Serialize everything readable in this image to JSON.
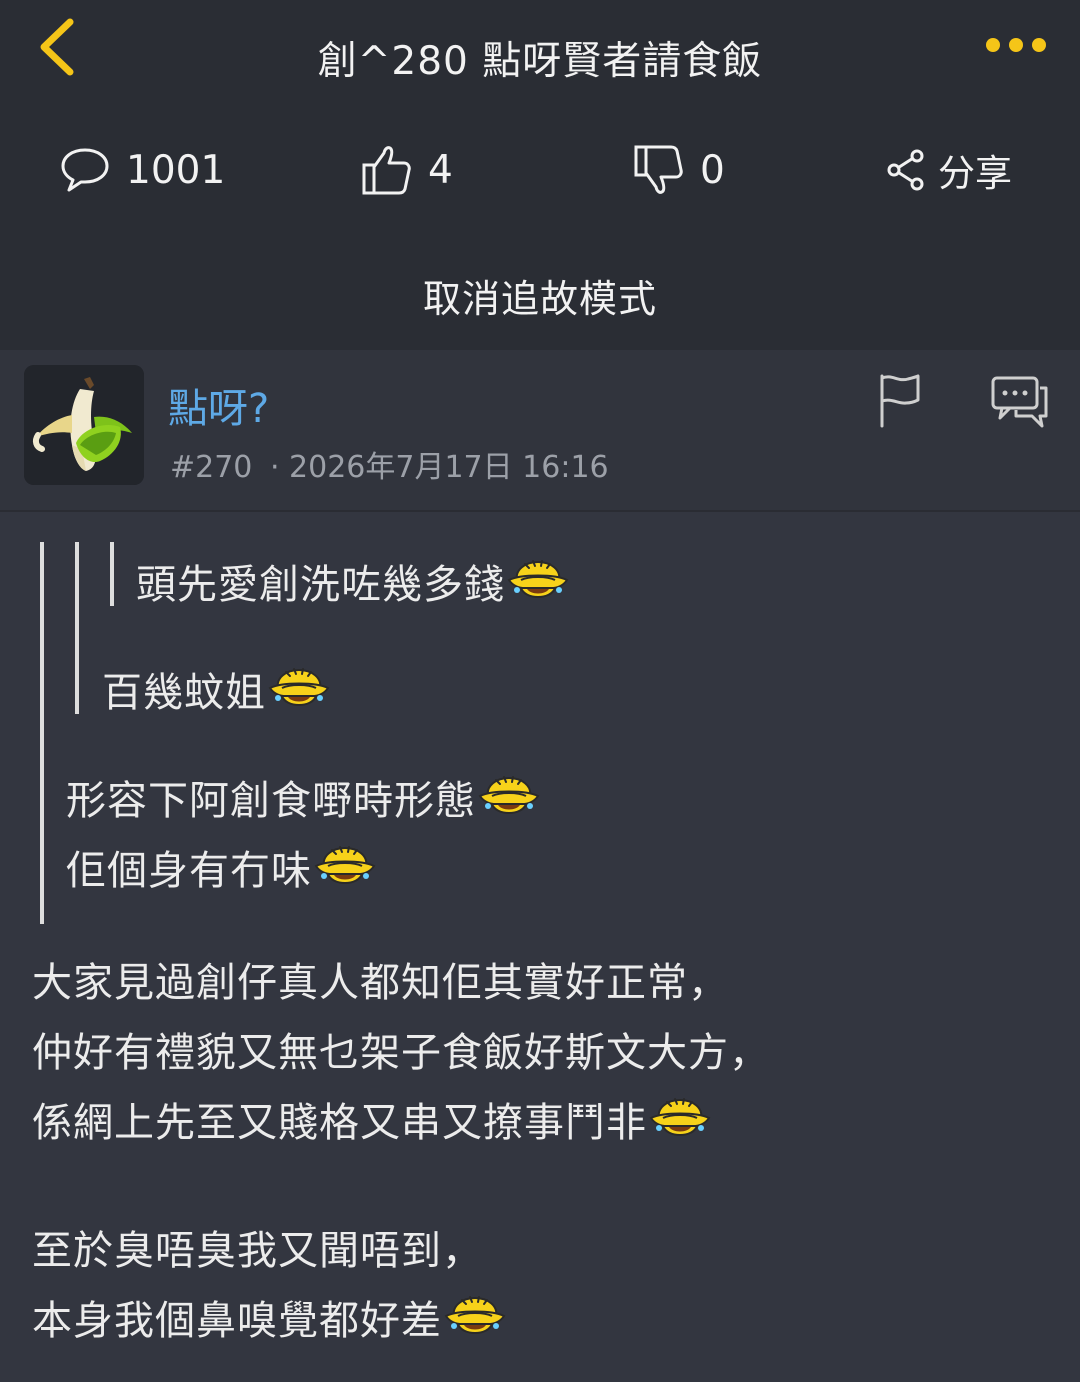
{
  "nav": {
    "title": "創^280 點呀賢者請食飯"
  },
  "stats": {
    "comments": "1001",
    "likes": "4",
    "dislikes": "0",
    "share_label": "分享"
  },
  "mode_toggle_label": "取消追故模式",
  "post": {
    "username": "點呀?",
    "floor": "#270",
    "timestamp": "· 2026年7月17日 16:16",
    "quote_level3": "頭先愛創洗咗幾多錢",
    "quote_level2": "百幾蚊姐",
    "quote_level1_line1": "形容下阿創食嘢時形態",
    "quote_level1_line2": "佢個身有冇味",
    "body_line1": "大家見過創仔真人都知佢其實好正常，",
    "body_line2": "仲好有禮貌又無乜架子食飯好斯文大方，",
    "body_line3": "係網上先至又賤格又串又撩事鬥非",
    "body_line4": "至於臭唔臭我又聞唔到，",
    "body_line5": "本身我個鼻嗅覺都好差"
  },
  "colors": {
    "accent": "#f5c518",
    "username": "#5ea9e6",
    "header_bg": "#2a2d34",
    "content_bg": "#333640"
  },
  "icons": [
    "back-chevron-icon",
    "more-dots-icon",
    "comment-bubble-icon",
    "thumbs-up-icon",
    "thumbs-down-icon",
    "share-icon",
    "flag-icon",
    "reply-chat-icon",
    "banana-avatar",
    "laughing-emoji-icon"
  ]
}
